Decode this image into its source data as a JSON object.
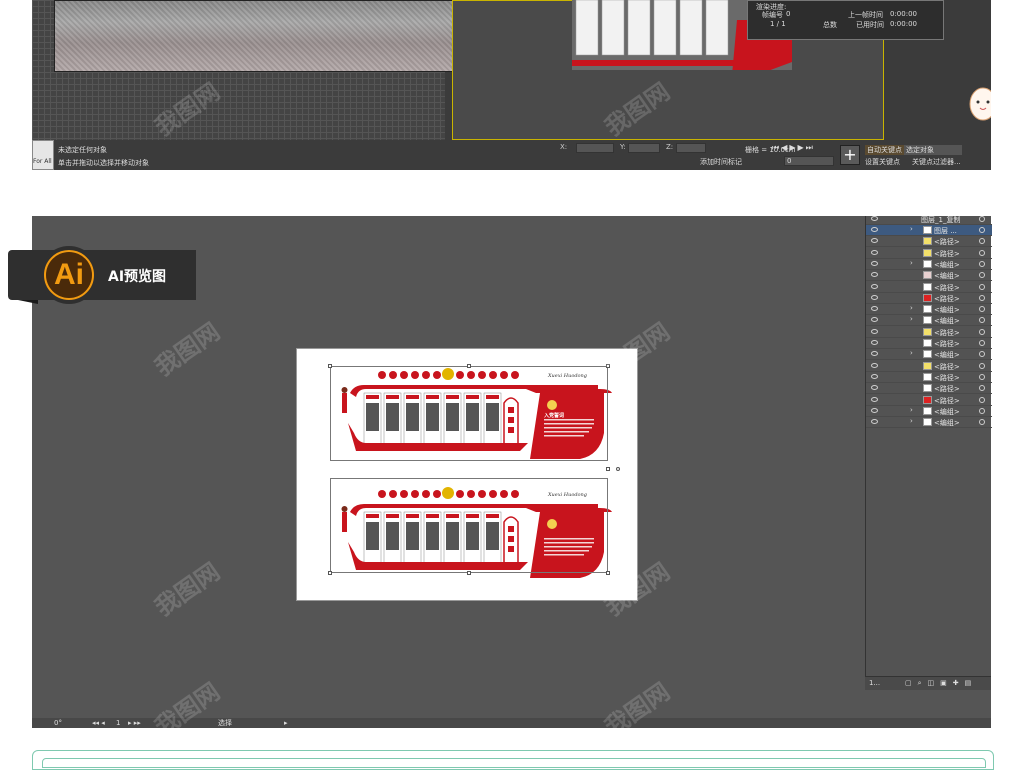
{
  "max_panel": {
    "render_dialog": {
      "progress_label": "渲染进度:",
      "frame_label": "帧编号",
      "frame_value": "0",
      "count": "1 / 1",
      "total_label": "总数",
      "prev_frame_label": "上一帧时间",
      "prev_frame_value": "0:00:00",
      "elapsed_label": "已用时间",
      "elapsed_value": "0:00:00"
    },
    "status_left_text": "For All",
    "status_line1": "未选定任何对象",
    "status_line2": "单击并拖动以选择并移动对象",
    "coord_x_label": "X:",
    "coord_y_label": "Y:",
    "coord_z_label": "Z:",
    "grid_label": "栅格 = 10.0cm",
    "time_tag": "添加时间标记",
    "frame_value": "0",
    "auto_key": "自动关键点",
    "set_key": "设置关键点",
    "selected_object": "选定对象",
    "key_filters": "关键点过滤器..."
  },
  "ai_panel": {
    "badge_logo": "Ai",
    "badge_title": "AI预览图",
    "layers": {
      "top_layer": "图层_1_复制",
      "rows": [
        {
          "name": "图层 ...",
          "has_arrow": true,
          "thumb": "#ffffff"
        },
        {
          "name": "<路径>",
          "has_arrow": false,
          "thumb": "#f3e06a"
        },
        {
          "name": "<路径>",
          "has_arrow": false,
          "thumb": "#f3e06a"
        },
        {
          "name": "<编组>",
          "has_arrow": true,
          "thumb": "#ffffff"
        },
        {
          "name": "<编组>",
          "has_arrow": false,
          "thumb": "#e8d0d0"
        },
        {
          "name": "<路径>",
          "has_arrow": false,
          "thumb": "#ffffff"
        },
        {
          "name": "<路径>",
          "has_arrow": false,
          "thumb": "#d22"
        },
        {
          "name": "<编组>",
          "has_arrow": true,
          "thumb": "#ffffff"
        },
        {
          "name": "<编组>",
          "has_arrow": true,
          "thumb": "#ffffff"
        },
        {
          "name": "<路径>",
          "has_arrow": false,
          "thumb": "#f3e06a"
        },
        {
          "name": "<路径>",
          "has_arrow": false,
          "thumb": "#ffffff"
        },
        {
          "name": "<编组>",
          "has_arrow": true,
          "thumb": "#ffffff"
        },
        {
          "name": "<路径>",
          "has_arrow": false,
          "thumb": "#f3e06a"
        },
        {
          "name": "<路径>",
          "has_arrow": false,
          "thumb": "#ffffff"
        },
        {
          "name": "<路径>",
          "has_arrow": false,
          "thumb": "#ffffff"
        },
        {
          "name": "<路径>",
          "has_arrow": false,
          "thumb": "#d22"
        },
        {
          "name": "<编组>",
          "has_arrow": true,
          "thumb": "#ffffff"
        },
        {
          "name": "<编组>",
          "has_arrow": true,
          "thumb": "#ffffff"
        }
      ],
      "footer_count": "1..."
    },
    "statusbar": {
      "zoom": "0°",
      "page": "1",
      "tool": "选择"
    }
  },
  "artboard": {
    "panel_title": "入党誓词"
  },
  "colors": {
    "accent_red": "#c8141d",
    "ai_orange": "#f29b11"
  },
  "watermark": "我图网"
}
